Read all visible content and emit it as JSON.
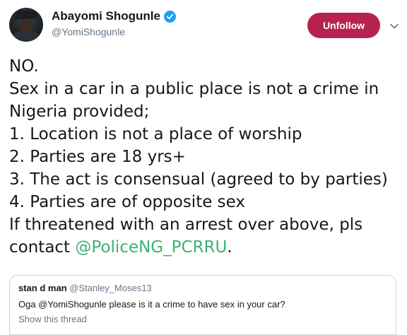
{
  "author": {
    "display_name": "Abayomi Shogunle",
    "handle": "@YomiShogunle",
    "verified_icon": "verified-badge-icon"
  },
  "header": {
    "follow_button_label": "Unfollow",
    "menu_icon": "chevron-down-icon"
  },
  "tweet": {
    "lines": [
      "NO.",
      "Sex in a car in a public place is not a crime in",
      "Nigeria provided;",
      "1. Location is not a place of worship",
      "2. Parties are 18 yrs+",
      "3. The act is consensual (agreed to by parties)",
      "4. Parties are of opposite sex",
      "If threatened with an arrest over above, pls"
    ],
    "last_line_prefix": "contact ",
    "mention": "@PoliceNG_PCRRU",
    "last_line_suffix": "."
  },
  "quoted_tweet": {
    "name": "stan d man",
    "handle": "@Stanley_Moses13",
    "text": "Oga @YomiShogunle please is it a crime to have sex in your car?",
    "show_thread_label": "Show this thread"
  },
  "colors": {
    "unfollow_bg": "#b7224e",
    "mention": "#3bb371",
    "verified": "#1da1f2",
    "secondary_text": "#657786"
  }
}
